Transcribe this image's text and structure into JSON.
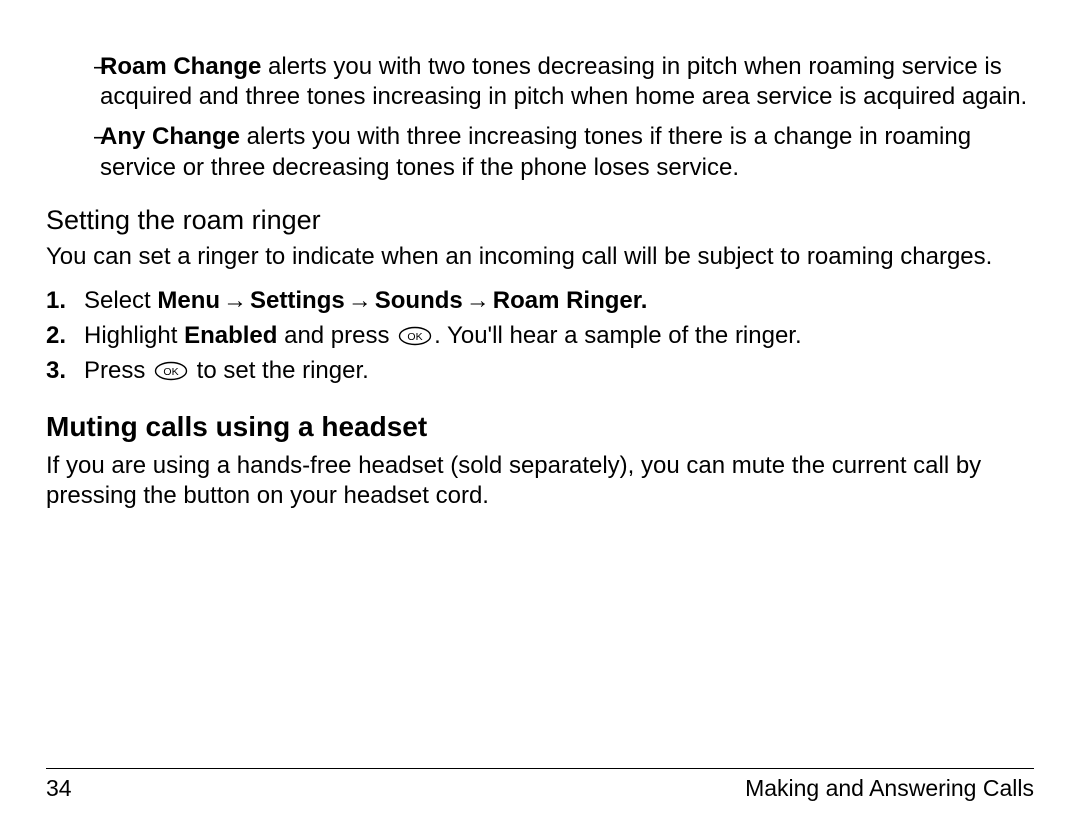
{
  "sub_bullets": [
    {
      "lead": "Roam Change",
      "rest": " alerts you with two tones decreasing in pitch when roaming service is acquired and three tones increasing in pitch when home area service is acquired again."
    },
    {
      "lead": "Any Change",
      "rest": " alerts you with three increasing tones if there is a change in roaming service or three decreasing tones if the phone loses service."
    }
  ],
  "subheading": "Setting the roam ringer",
  "roam_paragraph": "You can set a ringer to indicate when an incoming call will be subject to roaming charges.",
  "steps": {
    "s1": {
      "num": "1.",
      "prefix": "Select ",
      "path": [
        "Menu",
        "Settings",
        "Sounds",
        "Roam Ringer."
      ]
    },
    "s2": {
      "num": "2.",
      "t1": "Highlight ",
      "bold1": "Enabled",
      "t2": " and press ",
      "t3": ". You'll hear a sample of the ringer."
    },
    "s3": {
      "num": "3.",
      "t1": "Press ",
      "t2": " to set the ringer."
    }
  },
  "section_heading": "Muting calls using a headset",
  "headset_paragraph": "If you are using a hands-free headset (sold separately), you can mute the current call by pressing the button on your headset cord.",
  "footer": {
    "page_number": "34",
    "chapter": "Making and Answering Calls"
  },
  "glyphs": {
    "dash": "–",
    "arrow": "→",
    "ok_label": "OK"
  }
}
